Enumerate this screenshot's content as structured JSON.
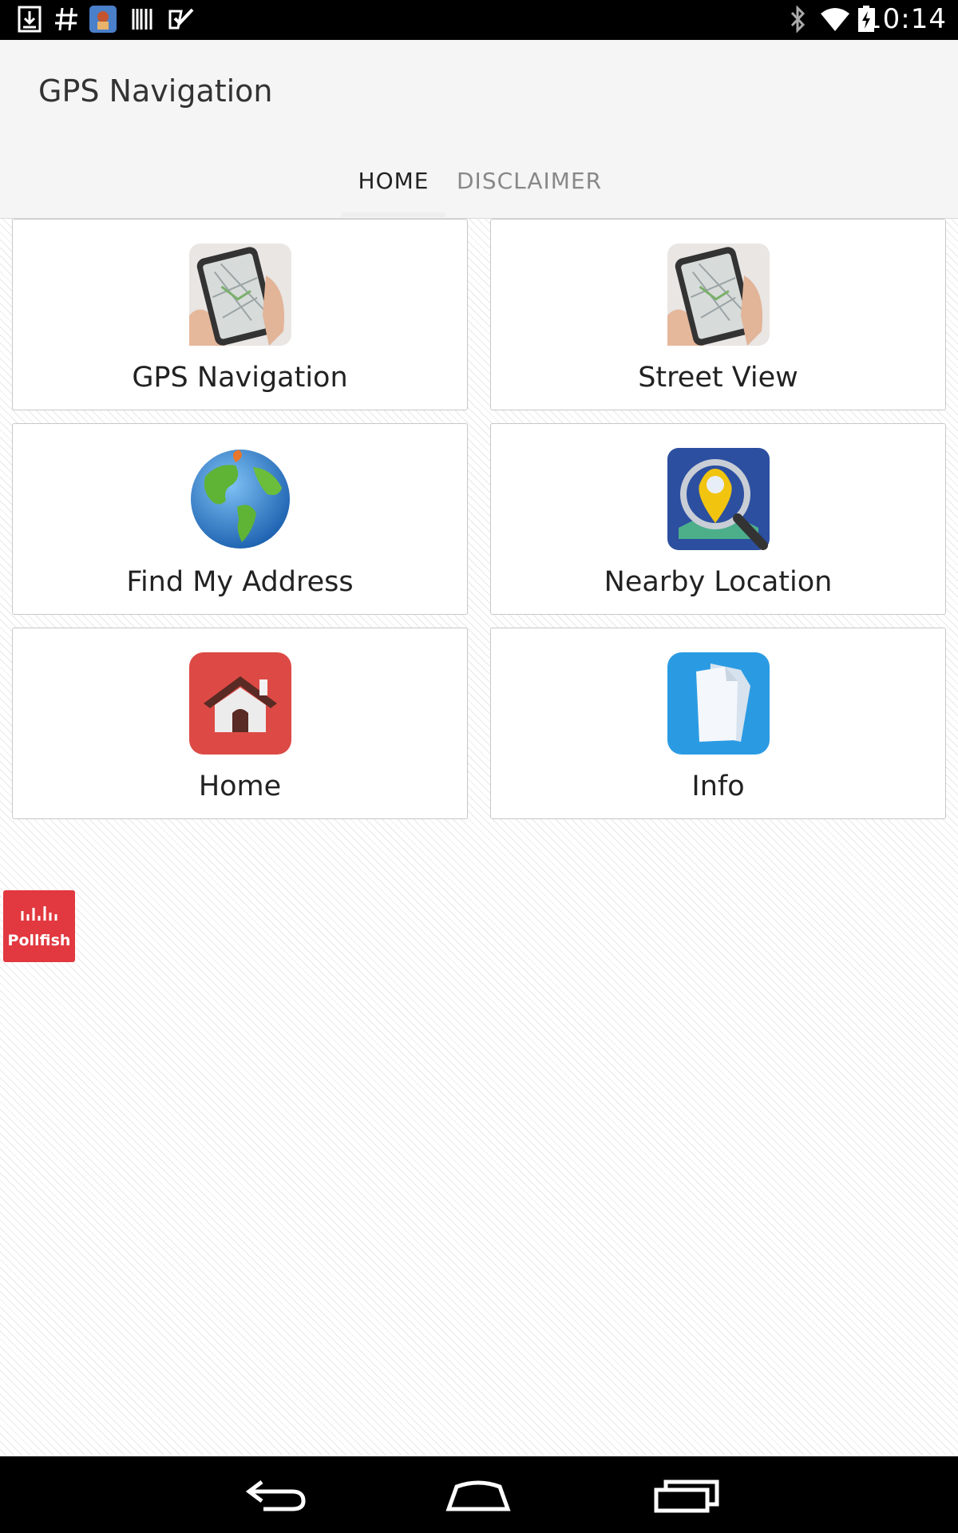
{
  "status_bar": {
    "time": "10:14",
    "left_icons": [
      "download-icon",
      "hash-icon",
      "app-icon",
      "barcode-icon",
      "check-icon"
    ],
    "right_icons": [
      "bluetooth-icon",
      "wifi-icon",
      "battery-icon"
    ]
  },
  "app_bar": {
    "title": "GPS Navigation",
    "tabs": [
      {
        "label": "HOME",
        "selected": true
      },
      {
        "label": "DISCLAIMER",
        "selected": false
      }
    ]
  },
  "tiles": [
    {
      "label": "GPS Navigation",
      "icon": "phone-map-icon"
    },
    {
      "label": "Street View",
      "icon": "phone-map-icon"
    },
    {
      "label": "Find My Address",
      "icon": "globe-icon"
    },
    {
      "label": "Nearby Location",
      "icon": "map-search-icon"
    },
    {
      "label": "Home",
      "icon": "house-icon"
    },
    {
      "label": "Info",
      "icon": "documents-icon"
    }
  ],
  "pollfish": {
    "label": "Pollfish"
  },
  "nav_bar": {
    "buttons": [
      "back-icon",
      "home-nav-icon",
      "recents-icon"
    ]
  }
}
